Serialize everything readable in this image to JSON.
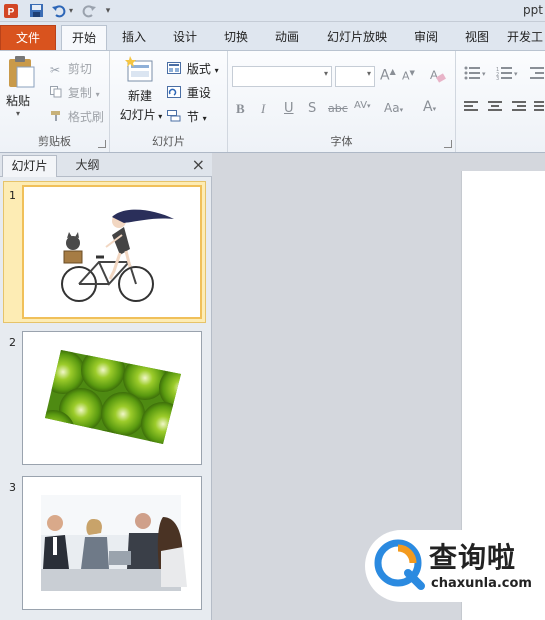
{
  "app": {
    "title": "ppt"
  },
  "ribbon_tabs": [
    {
      "label": "文件"
    },
    {
      "label": "开始"
    },
    {
      "label": "插入"
    },
    {
      "label": "设计"
    },
    {
      "label": "切换"
    },
    {
      "label": "动画"
    },
    {
      "label": "幻灯片放映"
    },
    {
      "label": "审阅"
    },
    {
      "label": "视图"
    },
    {
      "label": "开发工"
    }
  ],
  "clipboard": {
    "label": "剪贴板",
    "paste": "粘贴",
    "cut": "剪切",
    "copy": "复制",
    "format_painter": "格式刷"
  },
  "slides_group": {
    "label": "幻灯片",
    "new_slide_line1": "新建",
    "new_slide_line2": "幻灯片",
    "layout": "版式",
    "reset": "重设",
    "section": "节"
  },
  "font_group": {
    "label": "字体",
    "font_name": "",
    "font_size": ""
  },
  "panel": {
    "tabs": [
      "幻灯片",
      "大纲"
    ],
    "close": "×"
  },
  "slides": [
    {
      "number": "1"
    },
    {
      "number": "2"
    },
    {
      "number": "3"
    }
  ],
  "watermark": {
    "text": "查询啦",
    "url": "chaxunla.com"
  },
  "colors": {
    "file_tab": "#d9531e",
    "selection": "#fdecb4",
    "watermark_blue": "#2b8ae0",
    "watermark_orange": "#f39a1e"
  }
}
